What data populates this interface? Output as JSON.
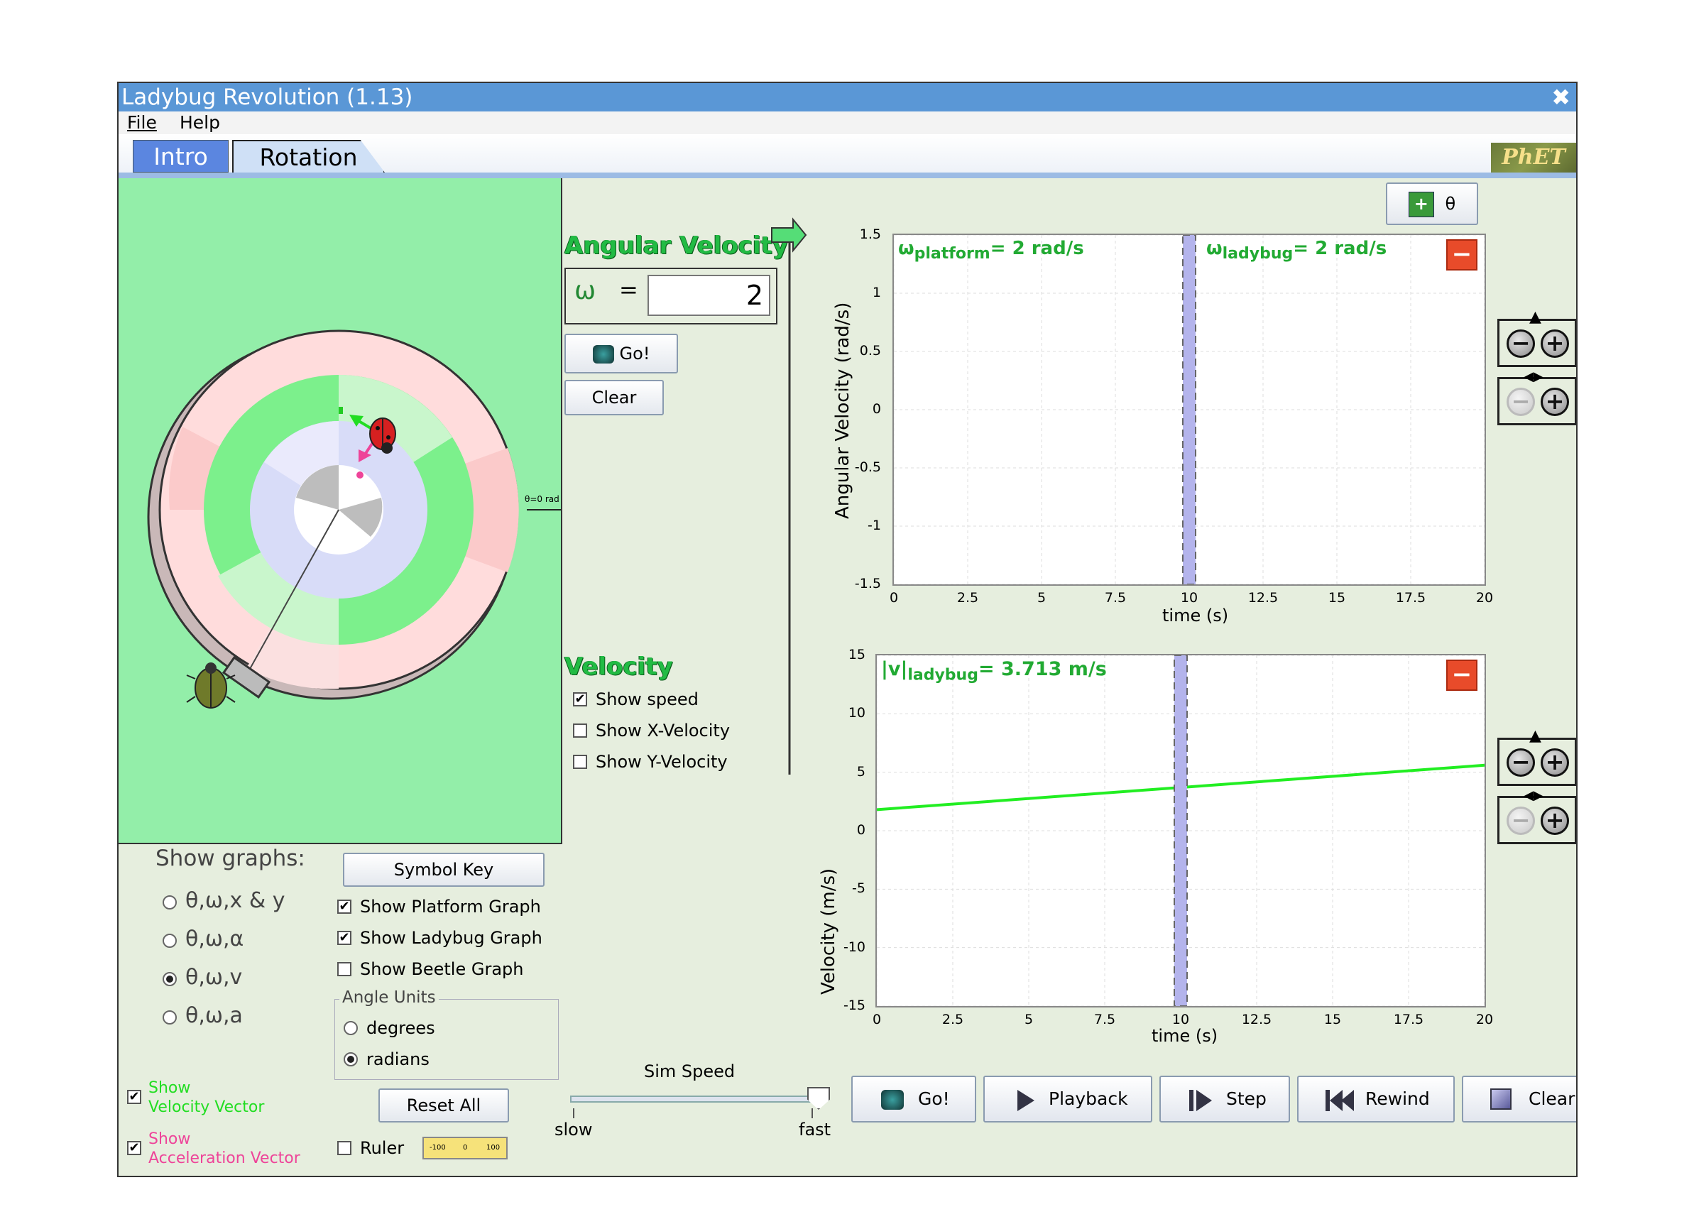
{
  "window": {
    "title": "Ladybug Revolution (1.13)",
    "close_glyph": "✖"
  },
  "menu": {
    "file": "File",
    "help": "Help"
  },
  "tabs": {
    "intro": "Intro",
    "rotation": "Rotation",
    "logo": "PhET"
  },
  "play_area": {
    "angle_ruler_label": "θ=0 rad",
    "colors": {
      "background": "#93eea9",
      "outer_ring": "#ffdcdc",
      "mid_ring": "#7cf08c",
      "inner_ring": "#d8dcf8"
    }
  },
  "angular_velocity": {
    "title": "Angular Velocity",
    "symbol": "ω",
    "equals": "=",
    "value": "2",
    "go_label": "Go!",
    "clear_label": "Clear"
  },
  "velocity_panel": {
    "title": "Velocity",
    "show_speed": {
      "label": "Show speed",
      "checked": true
    },
    "show_x": {
      "label": "Show X-Velocity",
      "checked": false
    },
    "show_y": {
      "label": "Show Y-Velocity",
      "checked": false
    }
  },
  "theta_button": {
    "label": "θ",
    "icon": "plus-icon"
  },
  "graph1": {
    "ylabel": "Angular Velocity (rad/s)",
    "xlabel": "time (s)",
    "readout_platform_main": "ω",
    "readout_platform_sub": "platform",
    "readout_platform_value": "= 2 rad/s",
    "readout_ladybug_main": "ω",
    "readout_ladybug_sub": "ladybug",
    "readout_ladybug_value": "= 2 rad/s",
    "yticks": [
      "1.5",
      "1",
      "0.5",
      "0",
      "-0.5",
      "-1",
      "-1.5"
    ],
    "xticks": [
      "0",
      "2.5",
      "5",
      "7.5",
      "10",
      "12.5",
      "15",
      "17.5",
      "20"
    ]
  },
  "graph2": {
    "ylabel": "Velocity (m/s)",
    "xlabel": "time (s)",
    "readout_main": "|v|",
    "readout_sub": "ladybug",
    "readout_value": "= 3.713 m/s",
    "yticks": [
      "15",
      "10",
      "5",
      "0",
      "-5",
      "-10",
      "-15"
    ],
    "xticks": [
      "0",
      "2.5",
      "5",
      "7.5",
      "10",
      "12.5",
      "15",
      "17.5",
      "20"
    ]
  },
  "show_graphs": {
    "title": "Show graphs:",
    "options": [
      "θ,ω,x & y",
      "θ,ω,α",
      "θ,ω,v",
      "θ,ω,a"
    ],
    "selected": 2
  },
  "options": {
    "symbol_key": "Symbol Key",
    "show_platform_graph": {
      "label": "Show Platform Graph",
      "checked": true
    },
    "show_ladybug_graph": {
      "label": "Show Ladybug Graph",
      "checked": true
    },
    "show_beetle_graph": {
      "label": "Show Beetle Graph",
      "checked": false
    },
    "angle_units_title": "Angle Units",
    "degrees": "degrees",
    "radians": "radians",
    "angle_units_selected": "radians",
    "reset_all": "Reset All",
    "ruler": {
      "label": "Ruler",
      "checked": false,
      "marks": [
        "-100",
        "0",
        "100"
      ]
    }
  },
  "vectors": {
    "velocity": {
      "line1": "Show",
      "line2": "Velocity Vector",
      "checked": true,
      "color": "#22dd22"
    },
    "acceleration": {
      "line1": "Show",
      "line2": "Acceleration Vector",
      "checked": true,
      "color": "#ee4499"
    }
  },
  "sim_speed": {
    "title": "Sim Speed",
    "slow": "slow",
    "fast": "fast",
    "level": 1.0
  },
  "controls": {
    "go": "Go!",
    "playback": "Playback",
    "step": "Step",
    "rewind": "Rewind",
    "clear": "Clear"
  },
  "chart_data": [
    {
      "type": "line",
      "xlabel": "time (s)",
      "ylabel": "Angular Velocity (rad/s)",
      "xlim": [
        0,
        20
      ],
      "ylim": [
        -1.5,
        1.5
      ],
      "cursor_time": 10,
      "series": []
    },
    {
      "type": "line",
      "xlabel": "time (s)",
      "ylabel": "Velocity (m/s)",
      "xlim": [
        0,
        20
      ],
      "ylim": [
        -15,
        15
      ],
      "cursor_time": 10,
      "series": [
        {
          "x": [
            0,
            10,
            20
          ],
          "y": [
            1.8,
            3.7,
            5.6
          ],
          "color": "#22ee22"
        }
      ]
    }
  ]
}
